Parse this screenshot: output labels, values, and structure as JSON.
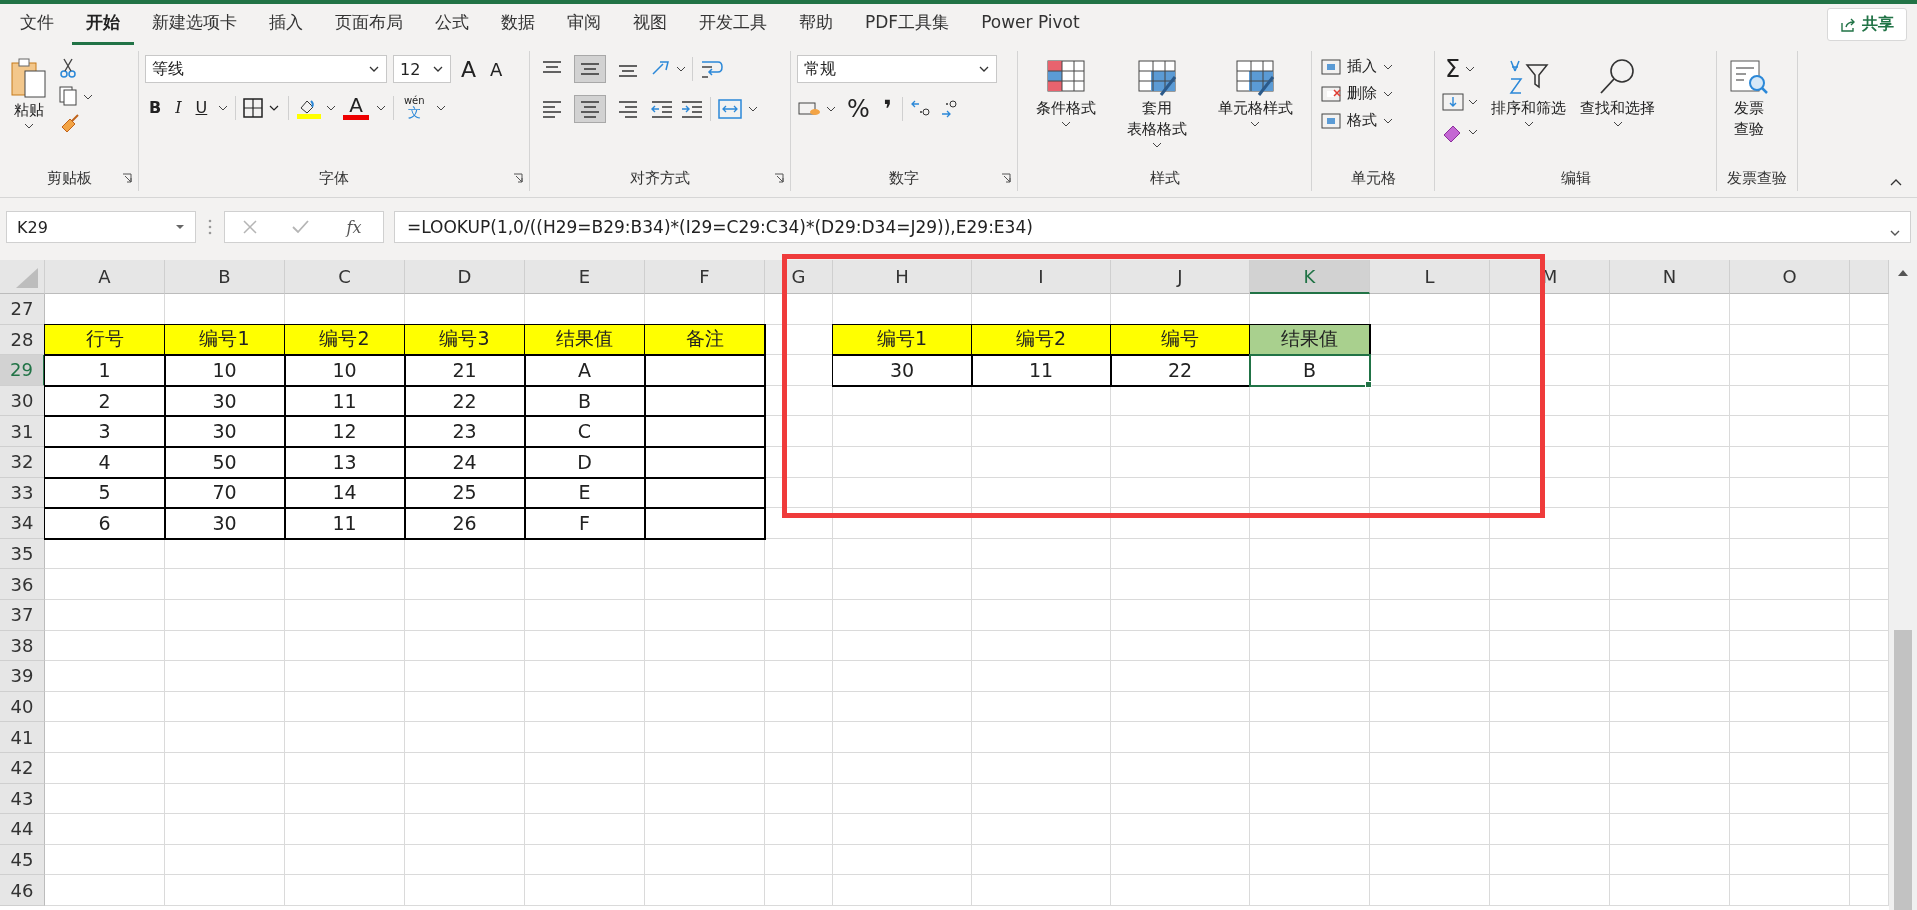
{
  "ribbon_tabs": [
    {
      "label": "文件",
      "selected": false
    },
    {
      "label": "开始",
      "selected": true
    },
    {
      "label": "新建选项卡",
      "selected": false
    },
    {
      "label": "插入",
      "selected": false
    },
    {
      "label": "页面布局",
      "selected": false
    },
    {
      "label": "公式",
      "selected": false
    },
    {
      "label": "数据",
      "selected": false
    },
    {
      "label": "审阅",
      "selected": false
    },
    {
      "label": "视图",
      "selected": false
    },
    {
      "label": "开发工具",
      "selected": false
    },
    {
      "label": "帮助",
      "selected": false
    },
    {
      "label": "PDF工具集",
      "selected": false
    },
    {
      "label": "Power Pivot",
      "selected": false
    }
  ],
  "share_button": "共享",
  "ribbon": {
    "clipboard": {
      "label": "剪贴板",
      "paste": "粘贴"
    },
    "font": {
      "label": "字体",
      "font_name": "等线",
      "font_size": "12",
      "grow": "A",
      "shrink": "A",
      "styles": [
        "B",
        "I",
        "U"
      ],
      "font_color_letter": "A",
      "phonetic_top": "wén",
      "phonetic_bottom": "文"
    },
    "alignment": {
      "label": "对齐方式",
      "vertical": [
        {
          "selected": false
        },
        {
          "selected": true
        },
        {
          "selected": false
        }
      ],
      "horizontal": [
        {
          "selected": false
        },
        {
          "selected": true
        },
        {
          "selected": false
        }
      ]
    },
    "number": {
      "label": "数字",
      "format": "常规",
      "percent": "%",
      "comma": "❜"
    },
    "styles": {
      "label": "样式",
      "buttons": [
        {
          "lines": [
            "条件格式"
          ]
        },
        {
          "lines": [
            "套用",
            "表格格式"
          ]
        },
        {
          "lines": [
            "单元格样式"
          ]
        }
      ]
    },
    "cells": {
      "label": "单元格",
      "buttons": [
        "插入",
        "删除",
        "格式"
      ]
    },
    "editing": {
      "label": "编辑",
      "sum": "Σ",
      "buttons": [
        "排序和筛选",
        "查找和选择"
      ]
    },
    "invoice": {
      "label": "发票查验",
      "lines": [
        "发票",
        "查验"
      ]
    }
  },
  "formula_bar": {
    "name_box": "K29",
    "fx": "fx",
    "formula": "=LOOKUP(1,0/((H29=B29:B34)*(I29=C29:C34)*(D29:D34=J29)),E29:E34)"
  },
  "columns": [
    {
      "label": "A",
      "selected": false
    },
    {
      "label": "B",
      "selected": false
    },
    {
      "label": "C",
      "selected": false
    },
    {
      "label": "D",
      "selected": false
    },
    {
      "label": "E",
      "selected": false
    },
    {
      "label": "F",
      "selected": false
    },
    {
      "label": "G",
      "selected": false
    },
    {
      "label": "H",
      "selected": false
    },
    {
      "label": "I",
      "selected": false
    },
    {
      "label": "J",
      "selected": false
    },
    {
      "label": "K",
      "selected": true
    },
    {
      "label": "L",
      "selected": false
    },
    {
      "label": "M",
      "selected": false
    },
    {
      "label": "N",
      "selected": false
    },
    {
      "label": "O",
      "selected": false
    }
  ],
  "rows": [
    {
      "number": "27",
      "selected": false,
      "cells": []
    },
    {
      "number": "28",
      "selected": false,
      "cells": [
        {
          "text": "行号",
          "color": "#ffff00",
          "bordered": true,
          "selected": false
        },
        {
          "text": "编号1",
          "color": "#ffff00",
          "bordered": true,
          "selected": false
        },
        {
          "text": "编号2",
          "color": "#ffff00",
          "bordered": true,
          "selected": false
        },
        {
          "text": "编号3",
          "color": "#ffff00",
          "bordered": true,
          "selected": false
        },
        {
          "text": "结果值",
          "color": "#ffff00",
          "bordered": true,
          "selected": false
        },
        {
          "text": "备注",
          "color": "#ffff00",
          "bordered": true,
          "selected": false
        },
        {
          "bordered": false,
          "selected": false
        },
        {
          "text": "编号1",
          "color": "#ffff00",
          "bordered": true,
          "selected": false
        },
        {
          "text": "编号2",
          "color": "#ffff00",
          "bordered": true,
          "selected": false
        },
        {
          "text": "编号",
          "color": "#ffff00",
          "bordered": true,
          "selected": false
        },
        {
          "text": "结果值",
          "color": "#a9d08e",
          "bordered": true,
          "selected": false
        },
        {
          "bordered": false,
          "selected": false
        },
        {
          "bordered": false,
          "selected": false
        },
        {
          "bordered": false,
          "selected": false
        },
        {
          "bordered": false,
          "selected": false
        }
      ]
    },
    {
      "number": "29",
      "selected": true,
      "cells": [
        {
          "text": "1",
          "bordered": true,
          "selected": false
        },
        {
          "text": "10",
          "bordered": true,
          "selected": false
        },
        {
          "text": "10",
          "bordered": true,
          "selected": false
        },
        {
          "text": "21",
          "bordered": true,
          "selected": false
        },
        {
          "text": "A",
          "bordered": true,
          "selected": false
        },
        {
          "bordered": true,
          "selected": false
        },
        {
          "bordered": false,
          "selected": false
        },
        {
          "text": "30",
          "bordered": true,
          "selected": false
        },
        {
          "text": "11",
          "bordered": true,
          "selected": false
        },
        {
          "text": "22",
          "bordered": true,
          "selected": false
        },
        {
          "text": "B",
          "bordered": true,
          "selected": true
        },
        {
          "bordered": false,
          "selected": false
        },
        {
          "bordered": false,
          "selected": false
        },
        {
          "bordered": false,
          "selected": false
        },
        {
          "bordered": false,
          "selected": false
        }
      ]
    },
    {
      "number": "30",
      "selected": false,
      "cells": [
        {
          "text": "2",
          "bordered": true,
          "selected": false
        },
        {
          "text": "30",
          "bordered": true,
          "selected": false
        },
        {
          "text": "11",
          "bordered": true,
          "selected": false
        },
        {
          "text": "22",
          "bordered": true,
          "selected": false
        },
        {
          "text": "B",
          "bordered": true,
          "selected": false
        },
        {
          "bordered": true,
          "selected": false
        }
      ]
    },
    {
      "number": "31",
      "selected": false,
      "cells": [
        {
          "text": "3",
          "bordered": true,
          "selected": false
        },
        {
          "text": "30",
          "bordered": true,
          "selected": false
        },
        {
          "text": "12",
          "bordered": true,
          "selected": false
        },
        {
          "text": "23",
          "bordered": true,
          "selected": false
        },
        {
          "text": "C",
          "bordered": true,
          "selected": false
        },
        {
          "bordered": true,
          "selected": false
        }
      ]
    },
    {
      "number": "32",
      "selected": false,
      "cells": [
        {
          "text": "4",
          "bordered": true,
          "selected": false
        },
        {
          "text": "50",
          "bordered": true,
          "selected": false
        },
        {
          "text": "13",
          "bordered": true,
          "selected": false
        },
        {
          "text": "24",
          "bordered": true,
          "selected": false
        },
        {
          "text": "D",
          "bordered": true,
          "selected": false
        },
        {
          "bordered": true,
          "selected": false
        }
      ]
    },
    {
      "number": "33",
      "selected": false,
      "cells": [
        {
          "text": "5",
          "bordered": true,
          "selected": false
        },
        {
          "text": "70",
          "bordered": true,
          "selected": false
        },
        {
          "text": "14",
          "bordered": true,
          "selected": false
        },
        {
          "text": "25",
          "bordered": true,
          "selected": false
        },
        {
          "text": "E",
          "bordered": true,
          "selected": false
        },
        {
          "bordered": true,
          "selected": false
        }
      ]
    },
    {
      "number": "34",
      "selected": false,
      "cells": [
        {
          "text": "6",
          "bordered": true,
          "selected": false
        },
        {
          "text": "30",
          "bordered": true,
          "selected": false
        },
        {
          "text": "11",
          "bordered": true,
          "selected": false
        },
        {
          "text": "26",
          "bordered": true,
          "selected": false
        },
        {
          "text": "F",
          "bordered": true,
          "selected": false
        },
        {
          "bordered": true,
          "selected": false
        }
      ]
    },
    {
      "number": "35",
      "selected": false,
      "cells": []
    },
    {
      "number": "36",
      "selected": false,
      "cells": []
    },
    {
      "number": "37",
      "selected": false,
      "cells": []
    },
    {
      "number": "38",
      "selected": false,
      "cells": []
    },
    {
      "number": "39",
      "selected": false,
      "cells": []
    },
    {
      "number": "40",
      "selected": false,
      "cells": []
    },
    {
      "number": "41",
      "selected": false,
      "cells": []
    },
    {
      "number": "42",
      "selected": false,
      "cells": []
    },
    {
      "number": "43",
      "selected": false,
      "cells": []
    },
    {
      "number": "44",
      "selected": false,
      "cells": []
    },
    {
      "number": "45",
      "selected": false,
      "cells": []
    },
    {
      "number": "46",
      "selected": false,
      "cells": []
    }
  ]
}
